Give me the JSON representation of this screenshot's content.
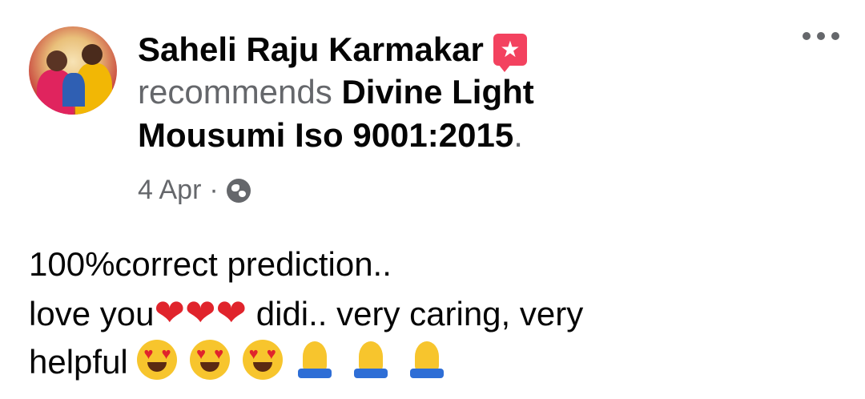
{
  "post": {
    "author": "Saheli Raju Karmakar",
    "action": "recommends",
    "page_name_line1": "Divine Light",
    "page_name_line2": "Mousumi  Iso 9001:2015",
    "trailing_period": ".",
    "date": "4 Apr",
    "separator": "·",
    "body_line1": "100%correct prediction..",
    "body_line2_prefix": "love you",
    "body_line2_hearts": "❤❤❤",
    "body_line2_suffix": " didi.. very caring, very",
    "body_line3_prefix": "helpful ",
    "icons": {
      "badge": "recommend-star-icon",
      "privacy": "globe-icon",
      "menu": "more-options-icon"
    }
  },
  "colors": {
    "text": "#050505",
    "muted": "#65676b",
    "badge": "#f3425f",
    "heart": "#e0242c"
  }
}
